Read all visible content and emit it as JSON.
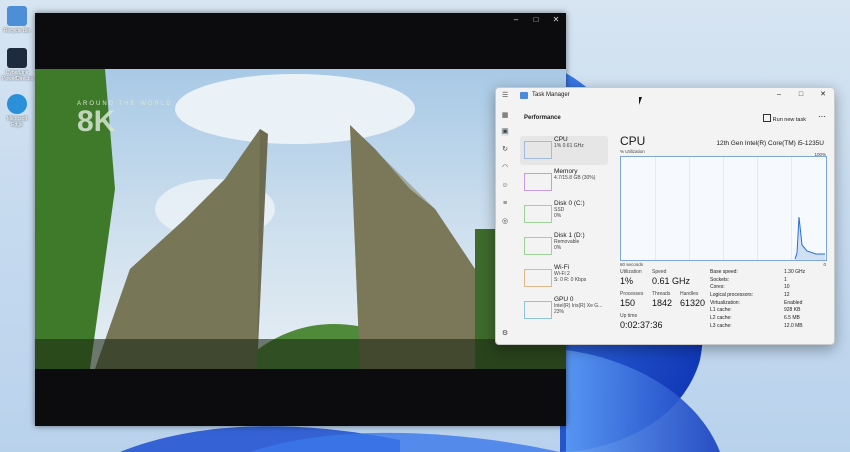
{
  "desktop": {
    "icons": [
      {
        "label": "Recycle Bin",
        "color": "#4c8fd6"
      },
      {
        "label": "CyberLink PowerDirector",
        "color": "#1e2b3f"
      },
      {
        "label": "Microsoft Edge",
        "color": "#2b8fd9"
      }
    ]
  },
  "video_player": {
    "overlay_small": "AROUND THE WORLD",
    "overlay_big": "8K",
    "controls": [
      "–",
      "□",
      "✕"
    ]
  },
  "task_manager": {
    "title": "Task Manager",
    "controls": [
      "–",
      "□",
      "✕"
    ],
    "section_title": "Performance",
    "run_new_task": "Run new task",
    "more": "⋯",
    "resources": [
      {
        "name": "CPU",
        "line1": "1% 0.61 GHz",
        "line2": "",
        "active": true
      },
      {
        "name": "Memory",
        "line1": "4.7/15.8 GB (30%)",
        "line2": ""
      },
      {
        "name": "Disk 0 (C:)",
        "line1": "SSD",
        "line2": "0%"
      },
      {
        "name": "Disk 1 (D:)",
        "line1": "Removable",
        "line2": "0%"
      },
      {
        "name": "Wi-Fi",
        "line1": "Wi-Fi 2",
        "line2": "S: 0 R: 0 Kbps"
      },
      {
        "name": "GPU 0",
        "line1": "Intel(R) Iris(R) Xe G...",
        "line2": "23%"
      }
    ],
    "cpu": {
      "heading": "CPU",
      "model": "12th Gen Intel(R) Core(TM) i5-1235U",
      "util_label": "% Utilization",
      "max_label": "100%",
      "time_label": "60 seconds",
      "min_label": "0",
      "utilization_label": "Utilization",
      "utilization": "1%",
      "speed_label": "Speed",
      "speed": "0.61 GHz",
      "processes_label": "Processes",
      "processes": "150",
      "threads_label": "Threads",
      "threads": "1842",
      "handles_label": "Handles",
      "handles": "61320",
      "uptime_label": "Up time",
      "uptime": "0:02:37:36",
      "details": [
        {
          "k": "Base speed:",
          "v": "1.30 GHz"
        },
        {
          "k": "Sockets:",
          "v": "1"
        },
        {
          "k": "Cores:",
          "v": "10"
        },
        {
          "k": "Logical processors:",
          "v": "12"
        },
        {
          "k": "Virtualization:",
          "v": "Enabled"
        },
        {
          "k": "L1 cache:",
          "v": "928 KB"
        },
        {
          "k": "L2 cache:",
          "v": "6.5 MB"
        },
        {
          "k": "L3 cache:",
          "v": "12.0 MB"
        }
      ],
      "accent": "#2b6fd6"
    }
  }
}
